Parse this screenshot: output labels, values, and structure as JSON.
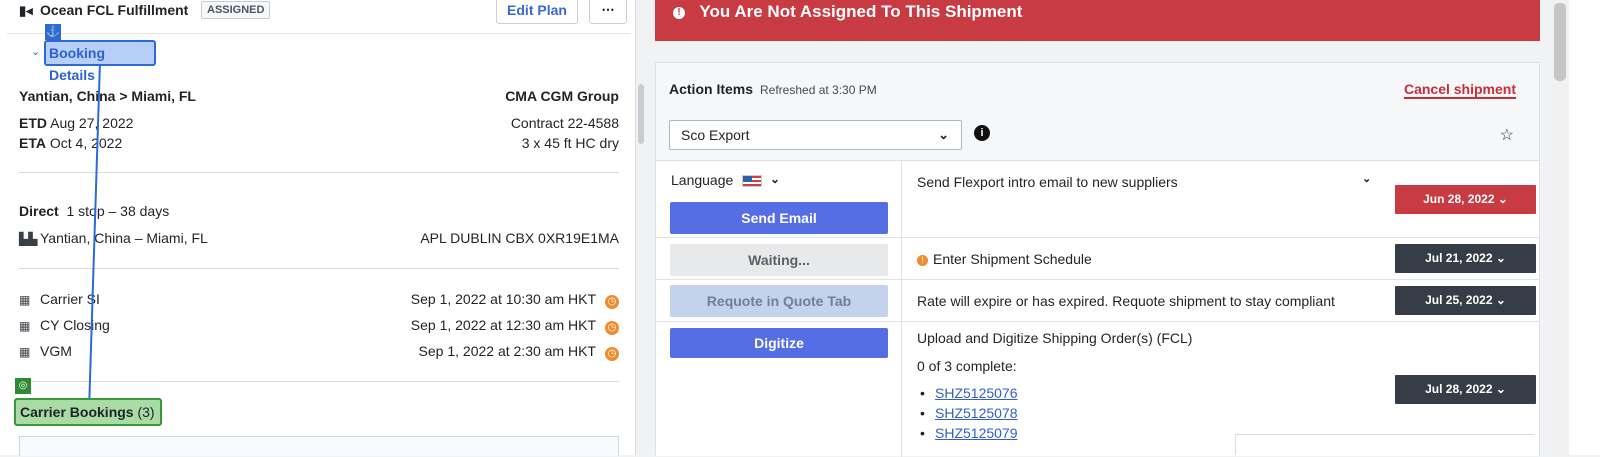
{
  "header": {
    "brand_icon": "flexport-logo",
    "title": "Ocean FCL Fulfillment",
    "status": "ASSIGNED",
    "edit_plan": "Edit Plan",
    "more": "⋯"
  },
  "booking": {
    "section_label": "Booking Details",
    "anchor_icon": "⚓",
    "route": "Yantian, China > Miami, FL",
    "carrier": "CMA CGM Group",
    "etd_label": "ETD",
    "etd": "Aug 27, 2022",
    "eta_label": "ETA",
    "eta": "Oct 4, 2022",
    "contract": "Contract 22-4588",
    "container": "3 x 45 ft HC dry",
    "direct": "Direct",
    "stops": "1 stop – 38 days",
    "lane": "Yantian, China – Miami, FL",
    "vessel": "APL DUBLIN CBX 0XR19E1MA"
  },
  "deadlines": [
    {
      "label": "Carrier SI",
      "value": "Sep 1, 2022 at 10:30 am HKT"
    },
    {
      "label": "CY Closing",
      "value": "Sep 1, 2022 at 12:30 am HKT"
    },
    {
      "label": "VGM",
      "value": "Sep 1, 2022 at 2:30 am HKT"
    }
  ],
  "carrier_bookings": {
    "label": "Carrier Bookings",
    "count": "(3)",
    "target_icon": "◎"
  },
  "alert": {
    "text": "You Are Not Assigned To This Shipment",
    "icon": "!"
  },
  "actions": {
    "title": "Action Items",
    "refreshed": "Refreshed at 3:30 PM",
    "cancel": "Cancel shipment",
    "select_value": "Sco Export",
    "language_label": "Language",
    "rows": [
      {
        "button": "Send Email",
        "task": "Send Flexport intro email to new suppliers",
        "date": "Jun 28, 2022",
        "date_color": "#c93b43"
      },
      {
        "button": "Waiting...",
        "task": "Enter Shipment Schedule",
        "date": "Jul 21, 2022",
        "date_color": "#363d47"
      },
      {
        "button": "Requote in Quote Tab",
        "task": "Rate will expire or has expired. Requote shipment to stay compliant",
        "date": "Jul 25, 2022",
        "date_color": "#363d47"
      },
      {
        "button": "Digitize",
        "task": "Upload and Digitize Shipping Order(s) (FCL)",
        "progress": "0 of 3 complete:",
        "links": [
          "SHZ5125076",
          "SHZ5125078",
          "SHZ5125079"
        ],
        "date": "Jul 28, 2022",
        "date_color": "#363d47"
      }
    ]
  },
  "colors": {
    "accent": "#566ee4",
    "alert": "#c93b43",
    "warning": "#f08c2d",
    "dark_badge": "#363d47"
  }
}
